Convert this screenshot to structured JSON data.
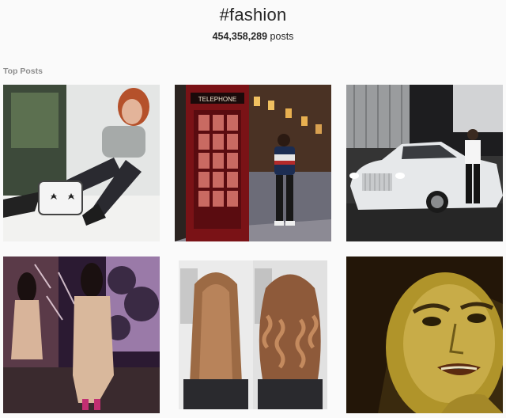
{
  "header": {
    "hashtag": "#fashion",
    "post_count": "454,358,289",
    "post_count_suffix": " posts"
  },
  "sections": {
    "top_posts_label": "Top Posts"
  },
  "phone_booth_sign": "TELEPHONE",
  "colors": {
    "background": "#fafafa",
    "text_primary": "#262626",
    "text_secondary": "#8e8e8e"
  }
}
